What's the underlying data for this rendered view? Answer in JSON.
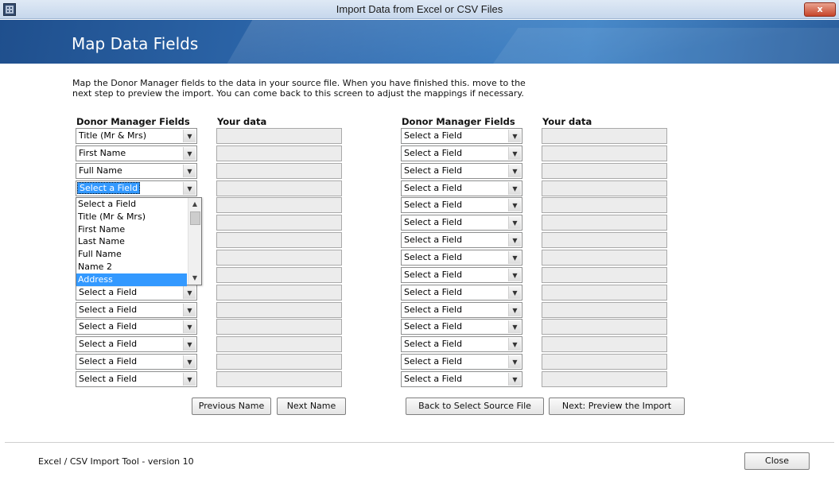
{
  "window": {
    "title": "Import Data from Excel or CSV Files",
    "close_label": "x"
  },
  "banner": {
    "heading": "Map Data Fields"
  },
  "instructions": {
    "line1": "Map the Donor Manager fields to the data in your source file.  When you have finished this. move to the",
    "line2": "next step to preview the import.  You can come back to this screen to adjust the mappings if necessary."
  },
  "left_panel": {
    "field_header": "Donor Manager Fields",
    "data_header": "Your data",
    "selects": [
      "Title (Mr & Mrs)",
      "First Name",
      "Full Name",
      "Select a Field",
      "",
      "",
      "",
      "",
      "",
      "Select a Field",
      "Select a Field",
      "Select a Field",
      "Select a Field",
      "Select a Field",
      "Select a Field"
    ]
  },
  "dropdown": {
    "options": [
      "Select a Field",
      "Title (Mr & Mrs)",
      "First Name",
      "Last Name",
      "Full Name",
      "Name 2",
      "Address"
    ],
    "selected_index": 6
  },
  "right_panel": {
    "field_header": "Donor Manager Fields",
    "data_header": "Your data",
    "selects": [
      "Select a Field",
      "Select a Field",
      "Select a Field",
      "Select a Field",
      "Select a Field",
      "Select a Field",
      "Select a Field",
      "Select a Field",
      "Select a Field",
      "Select a Field",
      "Select a Field",
      "Select a Field",
      "Select a Field",
      "Select a Field",
      "Select a Field"
    ]
  },
  "buttons": {
    "previous_name": "Previous Name",
    "next_name": "Next Name",
    "back_to_source": "Back to Select Source File",
    "next_preview": "Next: Preview the Import",
    "close": "Close"
  },
  "footer": {
    "version_text": "Excel / CSV Import Tool - version 10"
  }
}
